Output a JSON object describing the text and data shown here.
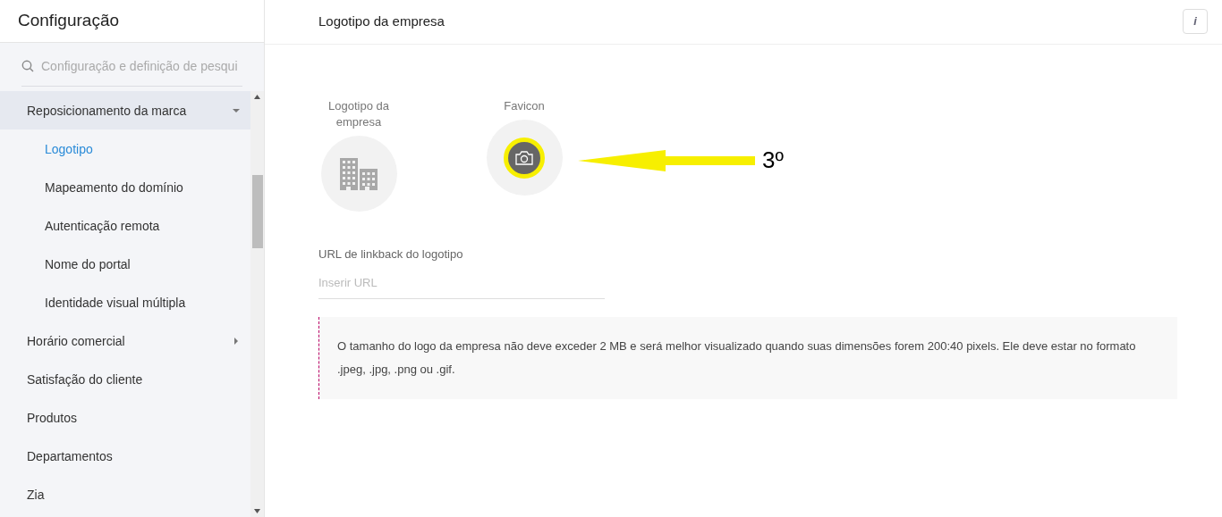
{
  "sidebar": {
    "title": "Configuração",
    "search": {
      "placeholder": "Configuração e definição de pesqui"
    },
    "items": [
      {
        "label": "Reposicionamento da marca",
        "kind": "group",
        "expanded": true,
        "selected": false,
        "children": [
          {
            "label": "Logotipo",
            "kind": "item",
            "selected": true
          },
          {
            "label": "Mapeamento do domínio",
            "kind": "item",
            "selected": false
          },
          {
            "label": "Autenticação remota",
            "kind": "item",
            "selected": false
          },
          {
            "label": "Nome do portal",
            "kind": "item",
            "selected": false
          },
          {
            "label": "Identidade visual múltipla",
            "kind": "item",
            "selected": false
          }
        ]
      },
      {
        "label": "Horário comercial",
        "kind": "group",
        "expanded": false,
        "selected": false
      },
      {
        "label": "Satisfação do cliente",
        "kind": "item",
        "selected": false
      },
      {
        "label": "Produtos",
        "kind": "item",
        "selected": false
      },
      {
        "label": "Departamentos",
        "kind": "item",
        "selected": false
      },
      {
        "label": "Zia",
        "kind": "item",
        "selected": false
      }
    ]
  },
  "main": {
    "title": "Logotipo da empresa",
    "info_button": "i",
    "uploads": [
      {
        "label": "Logotipo da empresa",
        "kind": "building",
        "highlighted": false
      },
      {
        "label": "Favicon",
        "kind": "camera",
        "highlighted": true
      }
    ],
    "annotation": "3º",
    "url_field": {
      "label": "URL de linkback do logotipo",
      "placeholder": "Inserir URL"
    },
    "note": "O tamanho do logo da empresa não deve exceder 2 MB e será melhor visualizado quando suas dimensões forem 200:40 pixels. Ele deve estar no formato .jpeg, .jpg, .png ou .gif."
  }
}
